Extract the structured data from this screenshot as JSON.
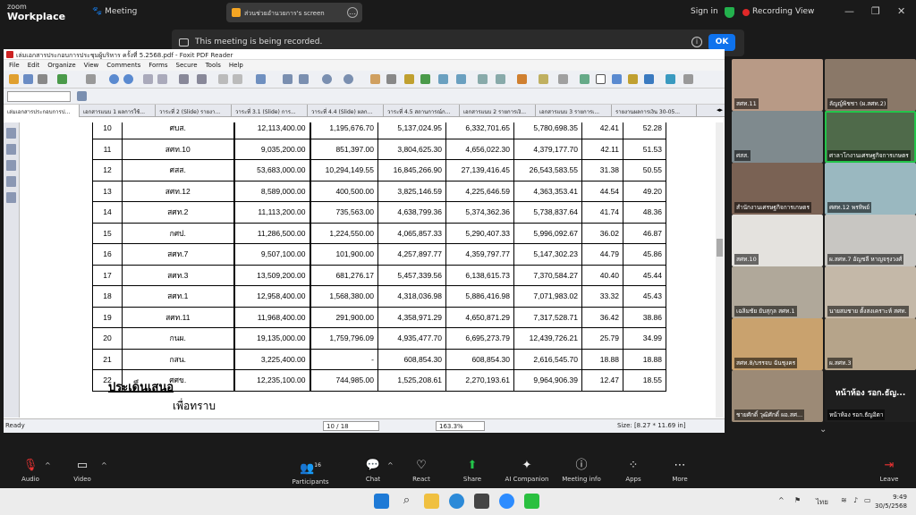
{
  "zoom": {
    "brand_top": "zoom",
    "brand_bottom": "Workplace",
    "meeting_label": "Meeting",
    "share_text": "ส่วนช่วยอำนวยการ's screen",
    "signin": "Sign in",
    "recording": "Recording",
    "view": "View",
    "banner_text": "This meeting is being recorded.",
    "ok_label": "OK"
  },
  "foxit": {
    "title": "เล่มเอกสารประกอบการประชุมผู้บริหาร ครั้งที่ 5.2568.pdf - Foxit PDF Reader",
    "menu": [
      "File",
      "Edit",
      "Organize",
      "View",
      "Comments",
      "Forms",
      "Secure",
      "Tools",
      "Help"
    ],
    "tabs": [
      "เล่มเอกสารประกอบการป...",
      "เอกสารแนบ 1 ผลการใช้...",
      "วาระที่ 2 (Slide) รายงา...",
      "วาระที่ 3.1 (Slide) การ...",
      "วาระที่ 4.4 (Slide) ผลก...",
      "วาระที่ 4.5 สถานการณ์ก...",
      "เอกสารแนบ 2 รายการเงิ...",
      "เอกสารแนบ 3 รายการเ...",
      "รายงานผลการเงิน 30-05..."
    ],
    "status_ready": "Ready",
    "page_indicator": "10 / 18",
    "zoom_value": "163.3%",
    "page_size": "Size: [8.27 * 11.69 in]"
  },
  "table": {
    "rows": [
      [
        "10",
        "ศบส.",
        "12,113,400.00",
        "1,195,676.70",
        "5,137,024.95",
        "6,332,701.65",
        "5,780,698.35",
        "42.41",
        "52.28"
      ],
      [
        "11",
        "สศท.10",
        "9,035,200.00",
        "851,397.00",
        "3,804,625.30",
        "4,656,022.30",
        "4,379,177.70",
        "42.11",
        "51.53"
      ],
      [
        "12",
        "ศสส.",
        "53,683,000.00",
        "10,294,149.55",
        "16,845,266.90",
        "27,139,416.45",
        "26,543,583.55",
        "31.38",
        "50.55"
      ],
      [
        "13",
        "สศท.12",
        "8,589,000.00",
        "400,500.00",
        "3,825,146.59",
        "4,225,646.59",
        "4,363,353.41",
        "44.54",
        "49.20"
      ],
      [
        "14",
        "สศท.2",
        "11,113,200.00",
        "735,563.00",
        "4,638,799.36",
        "5,374,362.36",
        "5,738,837.64",
        "41.74",
        "48.36"
      ],
      [
        "15",
        "กศป.",
        "11,286,500.00",
        "1,224,550.00",
        "4,065,857.33",
        "5,290,407.33",
        "5,996,092.67",
        "36.02",
        "46.87"
      ],
      [
        "16",
        "สศท.7",
        "9,507,100.00",
        "101,900.00",
        "4,257,897.77",
        "4,359,797.77",
        "5,147,302.23",
        "44.79",
        "45.86"
      ],
      [
        "17",
        "สศท.3",
        "13,509,200.00",
        "681,276.17",
        "5,457,339.56",
        "6,138,615.73",
        "7,370,584.27",
        "40.40",
        "45.44"
      ],
      [
        "18",
        "สศท.1",
        "12,958,400.00",
        "1,568,380.00",
        "4,318,036.98",
        "5,886,416.98",
        "7,071,983.02",
        "33.32",
        "45.43"
      ],
      [
        "19",
        "สศท.11",
        "11,968,400.00",
        "291,900.00",
        "4,358,971.29",
        "4,650,871.29",
        "7,317,528.71",
        "36.42",
        "38.86"
      ],
      [
        "20",
        "กนผ.",
        "19,135,000.00",
        "1,759,796.09",
        "4,935,477.70",
        "6,695,273.79",
        "12,439,726.21",
        "25.79",
        "34.99"
      ],
      [
        "21",
        "กสน.",
        "3,225,400.00",
        "-",
        "608,854.30",
        "608,854.30",
        "2,616,545.70",
        "18.88",
        "18.88"
      ],
      [
        "22",
        "ศศข.",
        "12,235,100.00",
        "744,985.00",
        "1,525,208.61",
        "2,270,193.61",
        "9,964,906.39",
        "12.47",
        "18.55"
      ]
    ],
    "heading": "ประเด็นเสนอ",
    "subheading": "เพื่อทราบ"
  },
  "participants": [
    {
      "name": "สศท.11",
      "bg": "#b89a86"
    },
    {
      "name": "ลัญญ์พิชชา (ผ.สศท.2)",
      "bg": "#8a7868"
    },
    {
      "name": "ศสส.",
      "bg": "#7f8a8e"
    },
    {
      "name": "ศาลาโกงานเศรษฐกิจการเกษตร",
      "bg": "#4f6a4a",
      "hl": true
    },
    {
      "name": "สำนักงานเศรษฐกิจการเกษตร",
      "bg": "#7a6254"
    },
    {
      "name": "ศศท.12 พรทิพย์",
      "bg": "#9ab8c0"
    },
    {
      "name": "สศท.10",
      "bg": "#e4e2de"
    },
    {
      "name": "ผ.สศท.7 อัญชลี หาญจรุงวงศ์",
      "bg": "#c8c6c2"
    },
    {
      "name": "เฉลิมชัย ยับสุกุล สศท.1",
      "bg": "#b0a89a"
    },
    {
      "name": "นายสมชาย ตั้งสงเคราะห์ สศท.",
      "bg": "#c4b8a8"
    },
    {
      "name": "สศท.8/บรรจบ ฉันชุงคร",
      "bg": "#c9a26e"
    },
    {
      "name": "ผ.สศท.3",
      "bg": "#b6a48a"
    },
    {
      "name": "ชายศักดิ์ วุฒิศักดิ์ ผอ.สศ...",
      "bg": "#9c8a76"
    },
    {
      "name": "หน้าห้อง รอก.ธัญอิตา",
      "bg": "#1f1f1f",
      "big": "หน้าห้อง รอก.ธัญ..."
    }
  ],
  "controls": {
    "audio": "Audio",
    "video": "Video",
    "participants": "Participants",
    "participant_count": "16",
    "chat": "Chat",
    "react": "React",
    "share": "Share",
    "ai": "AI Companion",
    "meeting_info": "Meeting info",
    "apps": "Apps",
    "more": "More",
    "leave": "Leave"
  },
  "taskbar": {
    "time": "9:49",
    "date": "30/5/2568",
    "lang": "ไทย"
  }
}
